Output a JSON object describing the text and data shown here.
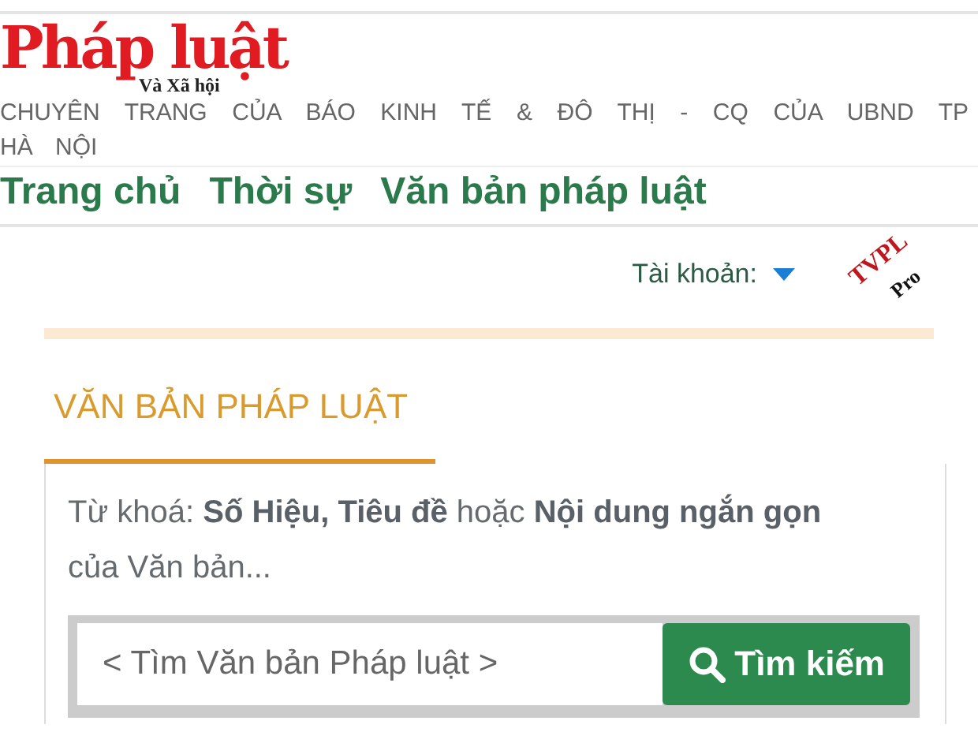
{
  "header": {
    "logo_title": "Pháp luật",
    "logo_subtitle": "Và Xã hội",
    "tagline": "CHUYÊN TRANG CỦA BÁO KINH TẾ & ĐÔ THỊ - CQ CỦA UBND TP HÀ NỘI"
  },
  "nav": [
    "Trang chủ",
    "Thời sự",
    "Văn bản pháp luật"
  ],
  "account": {
    "label": "Tài khoản:",
    "badge_top": "TVPL",
    "badge_bottom": "Pro"
  },
  "section": {
    "title": "VĂN BẢN PHÁP LUẬT",
    "hint": "Từ khoá: **Số Hiệu, Tiêu đề** hoặc **Nội dung ngắn gọn** của Văn bản...",
    "placeholder": "< Tìm Văn bản Pháp luật >",
    "button": "Tìm kiếm"
  }
}
